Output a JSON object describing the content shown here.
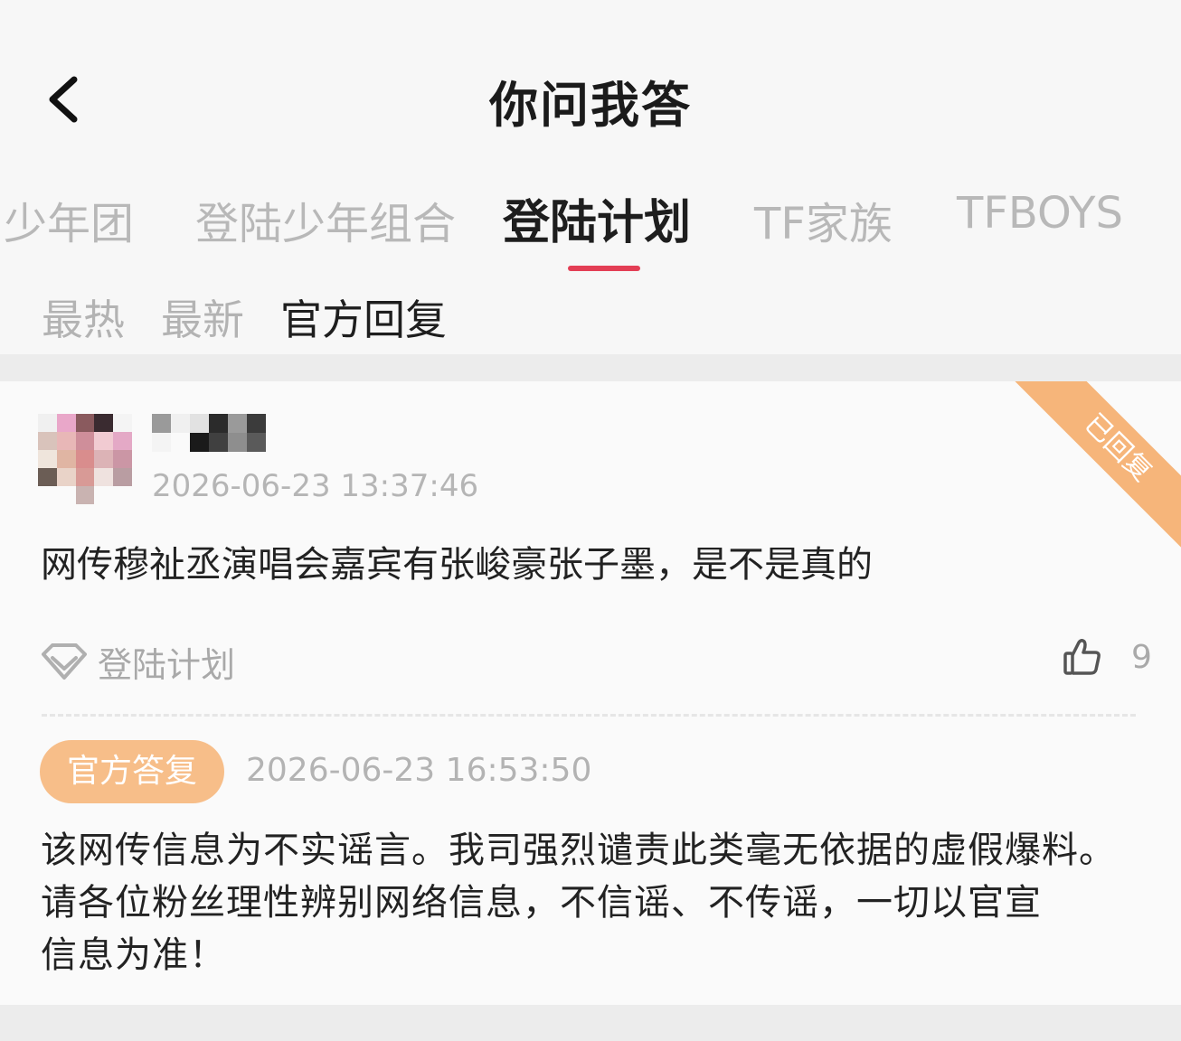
{
  "header": {
    "title": "你问我答",
    "tabs": [
      {
        "label": "少年团"
      },
      {
        "label": "登陆少年组合"
      },
      {
        "label": "登陆计划"
      },
      {
        "label": "TF家族"
      },
      {
        "label": "TFBOYS"
      }
    ],
    "active_tab_index": 2,
    "sort_options": [
      {
        "label": "最热"
      },
      {
        "label": "最新"
      },
      {
        "label": "官方回复"
      }
    ],
    "active_sort_index": 2
  },
  "post": {
    "status_ribbon": "已回复",
    "question_time": "2026-06-23 13:37:46",
    "question_text": "网传穆祉丞演唱会嘉宾有张峻豪张子墨，是不是真的",
    "topic_label": "登陆计划",
    "like_count": "9",
    "official_badge": "官方答复",
    "answer_time": "2026-06-23 16:53:50",
    "answer_lines": [
      "该网传信息为不实谣言。我司强烈谴责此类毫无依据的虚假爆料。",
      "请各位粉丝理性辨别网络信息，不信谣、不传谣，一切以官宣",
      "信息为准！"
    ]
  },
  "colors": {
    "accent_underline": "#e33e55",
    "official_badge_bg": "#f7be89",
    "ribbon_bg": "#f6b57a"
  },
  "icons": [
    "back-arrow-icon",
    "topic-diamond-icon",
    "thumbs-up-icon"
  ]
}
